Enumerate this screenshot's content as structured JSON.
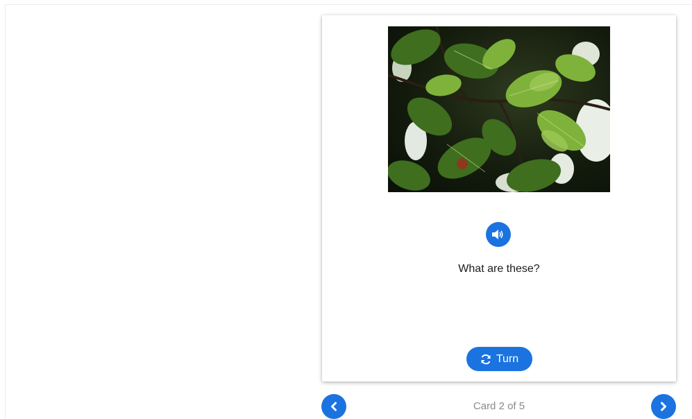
{
  "card": {
    "image_alt": "Green oak leaves",
    "question": "What are these?",
    "turn_label": "Turn"
  },
  "icons": {
    "audio": "speaker-icon",
    "turn": "rotate-icon",
    "prev": "chevron-left-icon",
    "next": "chevron-right-icon"
  },
  "pager": {
    "counter": "Card 2 of 5"
  },
  "colors": {
    "accent": "#1b73e0",
    "counter_text": "#8a8a8a"
  }
}
